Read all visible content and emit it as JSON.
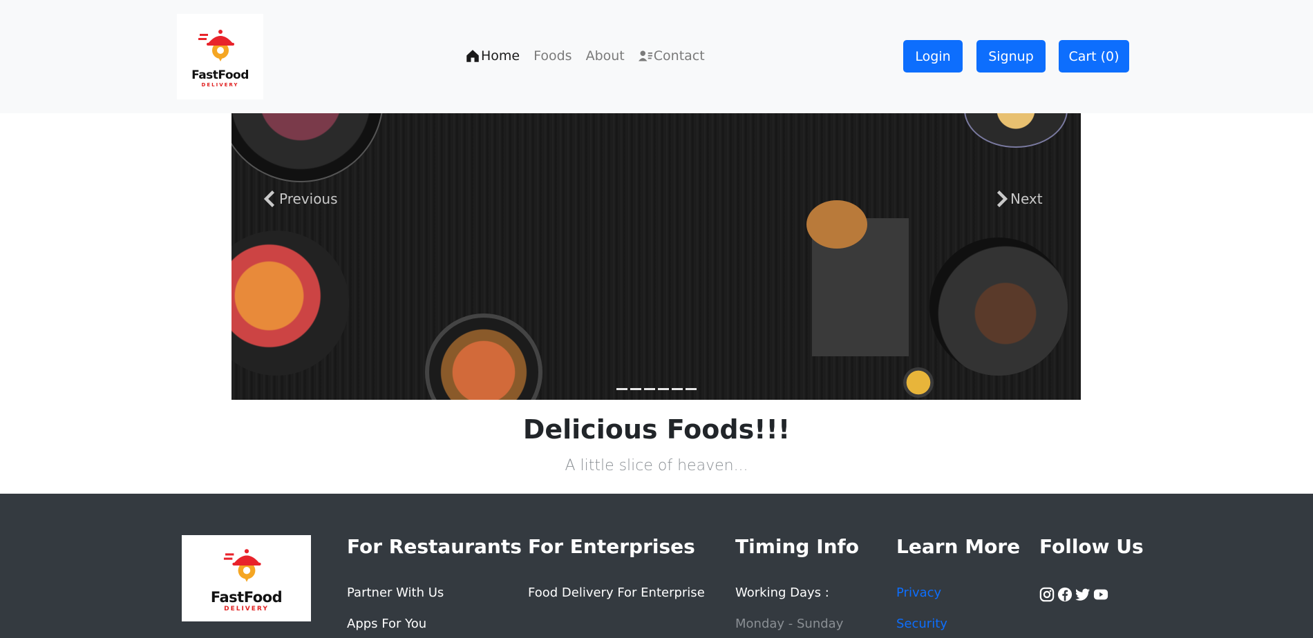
{
  "brand": {
    "name": "FastFood",
    "tagline": "DELIVERY",
    "logo_color": "#e8232b",
    "accent_orange": "#f5a623"
  },
  "nav": {
    "items": [
      {
        "label": "Home",
        "icon": "home-icon",
        "active": true
      },
      {
        "label": "Foods",
        "active": false
      },
      {
        "label": "About",
        "active": false
      },
      {
        "label": "Contact",
        "icon": "contact-card-icon",
        "active": false
      }
    ],
    "login": "Login",
    "signup": "Signup",
    "cart": "Cart (0)"
  },
  "carousel": {
    "prev": "Previous",
    "next": "Next",
    "indicator_count": 6
  },
  "hero": {
    "title": "Delicious Foods!!!",
    "subtitle": "A little slice of heaven..."
  },
  "footer": {
    "restaurants": {
      "heading": "For Restaurants",
      "items": [
        "Partner With Us",
        "Apps For You"
      ]
    },
    "enterprises": {
      "heading": "For Enterprises",
      "items": [
        "Food Delivery For Enterprise"
      ]
    },
    "timing": {
      "heading": "Timing Info",
      "items": [
        "Working Days :",
        "Monday - Sunday"
      ]
    },
    "learn": {
      "heading": "Learn More",
      "items": [
        "Privacy",
        "Security"
      ]
    },
    "follow": {
      "heading": "Follow Us",
      "icons": [
        "instagram-icon",
        "facebook-icon",
        "twitter-icon",
        "youtube-icon"
      ]
    }
  },
  "colors": {
    "primary": "#0d6efd",
    "navbar_bg": "#f8f9fa",
    "footer_bg": "#343a40"
  }
}
